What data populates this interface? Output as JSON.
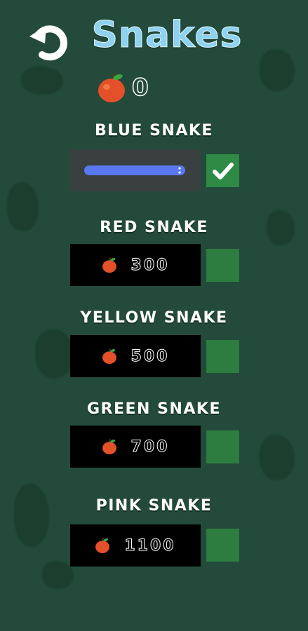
{
  "title": "Snakes",
  "apple_count": "0",
  "snakes": [
    {
      "name": "BLUE SNAKE",
      "price": "",
      "selected": true,
      "color": "#5a78f0"
    },
    {
      "name": "RED SNAKE",
      "price": "300",
      "selected": false
    },
    {
      "name": "YELLOW SNAKE",
      "price": "500",
      "selected": false
    },
    {
      "name": "GREEN SNAKE",
      "price": "700",
      "selected": false
    },
    {
      "name": "PINK SNAKE",
      "price": "1100",
      "selected": false
    }
  ],
  "icons": {
    "back": "undo-arrow-icon",
    "apple": "apple-icon",
    "check": "checkmark-icon"
  },
  "colors": {
    "background": "#234a3a",
    "title": "#8fd2ef",
    "checkbox": "#2f8a45",
    "apple": "#e4502a",
    "blue_snake": "#5a78f0"
  }
}
